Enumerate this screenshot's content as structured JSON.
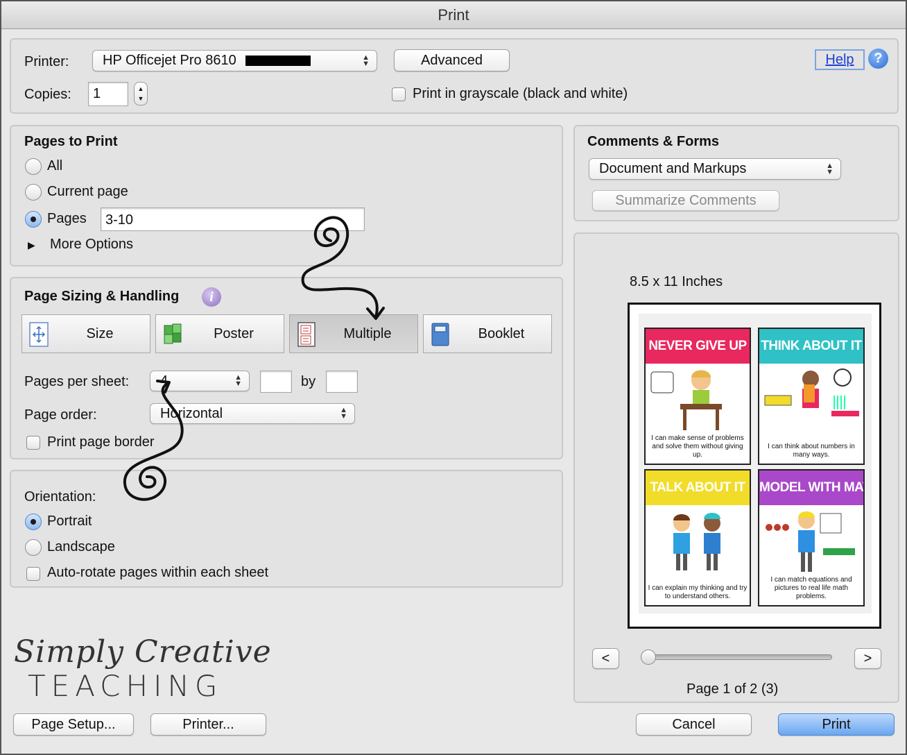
{
  "window": {
    "title": "Print"
  },
  "printer": {
    "label": "Printer:",
    "value": "HP Officejet Pro 8610",
    "advanced_label": "Advanced",
    "help_label": "Help",
    "help_icon": "?"
  },
  "copies": {
    "label": "Copies:",
    "value": "1",
    "grayscale_label": "Print in grayscale (black and white)"
  },
  "pages_to_print": {
    "title": "Pages to Print",
    "options": [
      "All",
      "Current page",
      "Pages"
    ],
    "selected": "Pages",
    "pages_value": "3-10",
    "more_options_label": "More Options"
  },
  "comments_forms": {
    "title": "Comments & Forms",
    "selected": "Document and Markups",
    "summarize_label": "Summarize Comments"
  },
  "sizing": {
    "title": "Page Sizing & Handling",
    "info_icon": "i",
    "tabs": [
      {
        "label": "Size",
        "icon": "size-icon"
      },
      {
        "label": "Poster",
        "icon": "poster-icon"
      },
      {
        "label": "Multiple",
        "icon": "multiple-icon"
      },
      {
        "label": "Booklet",
        "icon": "booklet-icon"
      }
    ],
    "active_tab": "Multiple",
    "pages_per_sheet_label": "Pages per sheet:",
    "pages_per_sheet_value": "4",
    "by_label": "by",
    "page_order_label": "Page order:",
    "page_order_value": "Horizontal",
    "print_border_label": "Print page border"
  },
  "orientation": {
    "title": "Orientation:",
    "options": [
      "Portrait",
      "Landscape"
    ],
    "selected": "Portrait",
    "auto_rotate_label": "Auto-rotate pages within each sheet"
  },
  "preview": {
    "size_label": "8.5 x 11 Inches",
    "pages": [
      {
        "header": "NEVER GIVE UP",
        "color": "#e8285e",
        "caption": "I can make sense of problems and solve them without giving up."
      },
      {
        "header": "THINK ABOUT IT",
        "color": "#2fc1c5",
        "caption": "I can think about numbers in many ways."
      },
      {
        "header": "TALK ABOUT IT",
        "color": "#f2dc2a",
        "caption": "I can explain my thinking and try to understand others."
      },
      {
        "header": "MODEL WITH MATH",
        "color": "#a948c9",
        "caption": "I can match equations and pictures to real life math problems."
      }
    ],
    "prev_label": "<",
    "next_label": ">",
    "page_status": "Page 1 of 2 (3)"
  },
  "logo": {
    "line1": "Simply Creative",
    "line2": "TEACHING"
  },
  "footer": {
    "page_setup_label": "Page Setup...",
    "printer_label": "Printer...",
    "cancel_label": "Cancel",
    "print_label": "Print"
  }
}
